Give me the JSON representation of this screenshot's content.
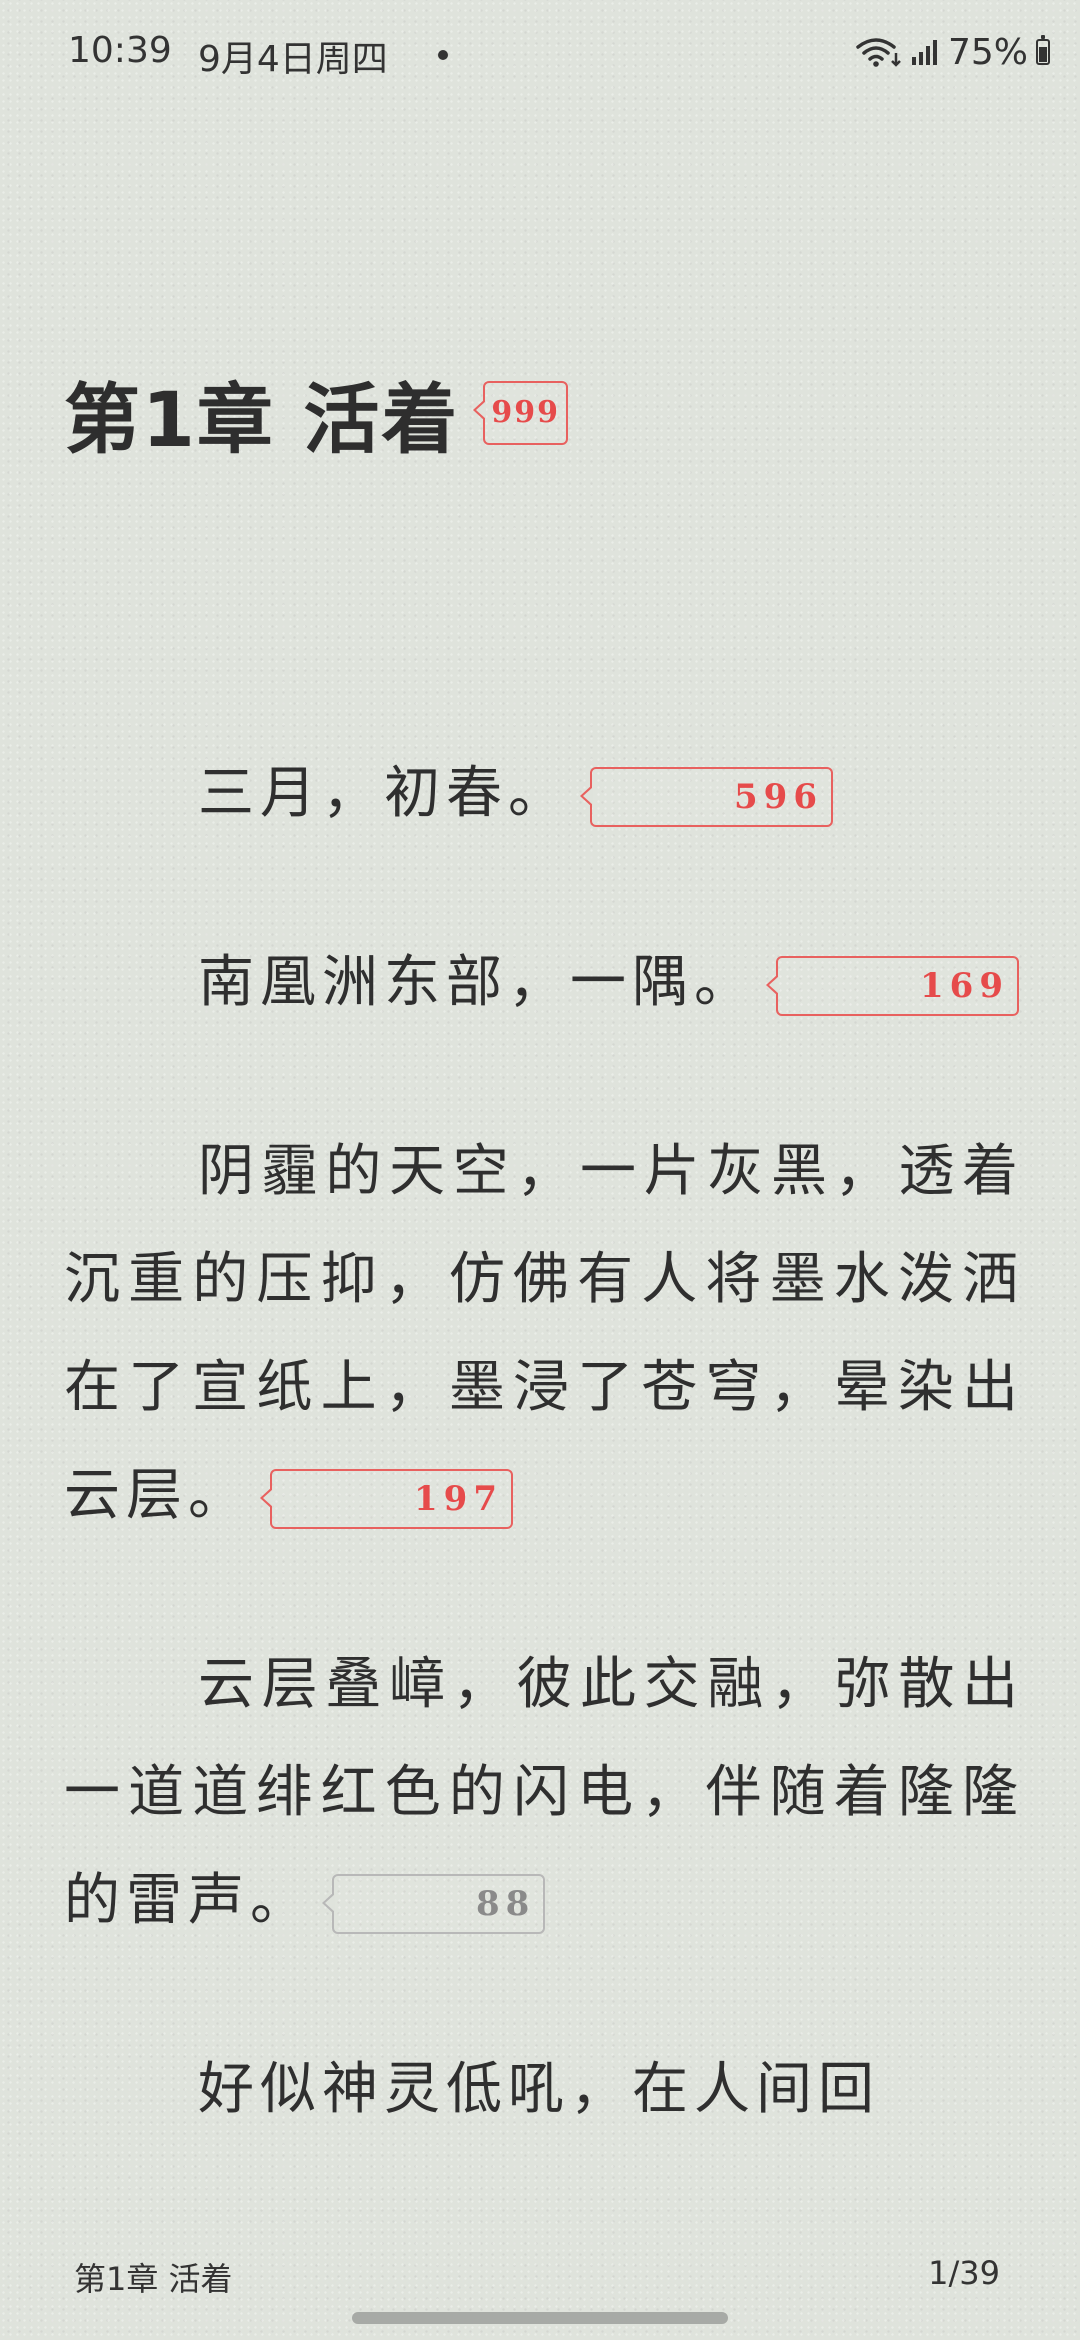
{
  "status_bar": {
    "time": "10:39",
    "date": "9月4日周四",
    "battery": "75%"
  },
  "chapter": {
    "title": "第1章 活着",
    "title_comment_count": "999"
  },
  "paragraphs": [
    {
      "text": "三月，初春。",
      "comment_count": "596",
      "badge_color": "#e64b4b"
    },
    {
      "text": "南凰洲东部，一隅。",
      "comment_count": "169",
      "badge_color": "#e64b4b"
    },
    {
      "text": "阴霾的天空，一片灰黑，透着沉重的压抑，仿佛有人将墨水泼洒在了宣纸上，墨浸了苍穹，晕染出云层。",
      "comment_count": "197",
      "badge_color": "#e64b4b"
    },
    {
      "text": "云层叠嶂，彼此交融，弥散出一道道绯红色的闪电，伴随着隆隆的雷声。",
      "comment_count": "88",
      "badge_color": "#8a8a8a"
    },
    {
      "text": "好似神灵低吼，在人间回",
      "comment_count": null,
      "badge_color": null
    }
  ],
  "footer": {
    "chapter_name": "第1章 活着",
    "page_indicator": "1/39"
  }
}
